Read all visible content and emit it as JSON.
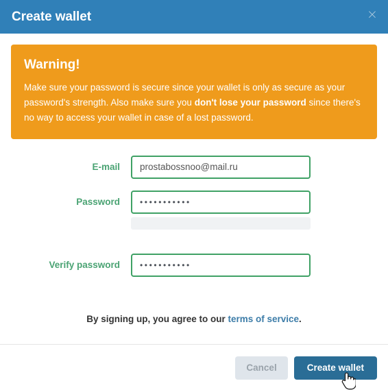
{
  "header": {
    "title": "Create wallet",
    "close_icon": "close-icon",
    "close_glyph": "×",
    "background_color": "#3080b8"
  },
  "alert": {
    "title": "Warning!",
    "text_before": "Make sure your password is secure since your wallet is only as secure as your password's strength. Also make sure you ",
    "text_bold": "don't lose your password",
    "text_after": " since there's no way to access your wallet in case of a lost password.",
    "background_color": "#ef9b1c"
  },
  "form": {
    "email": {
      "label": "E-mail",
      "value": "prostabossnoo@mail.ru",
      "placeholder": ""
    },
    "password": {
      "label": "Password",
      "value": "•••••••••••",
      "placeholder": "",
      "strength_percent": "0"
    },
    "verify_password": {
      "label": "Verify password",
      "value": "•••••••••••",
      "placeholder": ""
    },
    "label_color": "#4aa373",
    "border_color": "#3fa165"
  },
  "terms": {
    "text_before": "By signing up, you agree to our ",
    "link_text": "terms of service",
    "text_after": ".",
    "link_color": "#3c7ca8"
  },
  "footer": {
    "cancel_label": "Cancel",
    "submit_label": "Create wallet",
    "submit_color": "#2a6d96",
    "cancel_color": "#dfe5eb"
  }
}
